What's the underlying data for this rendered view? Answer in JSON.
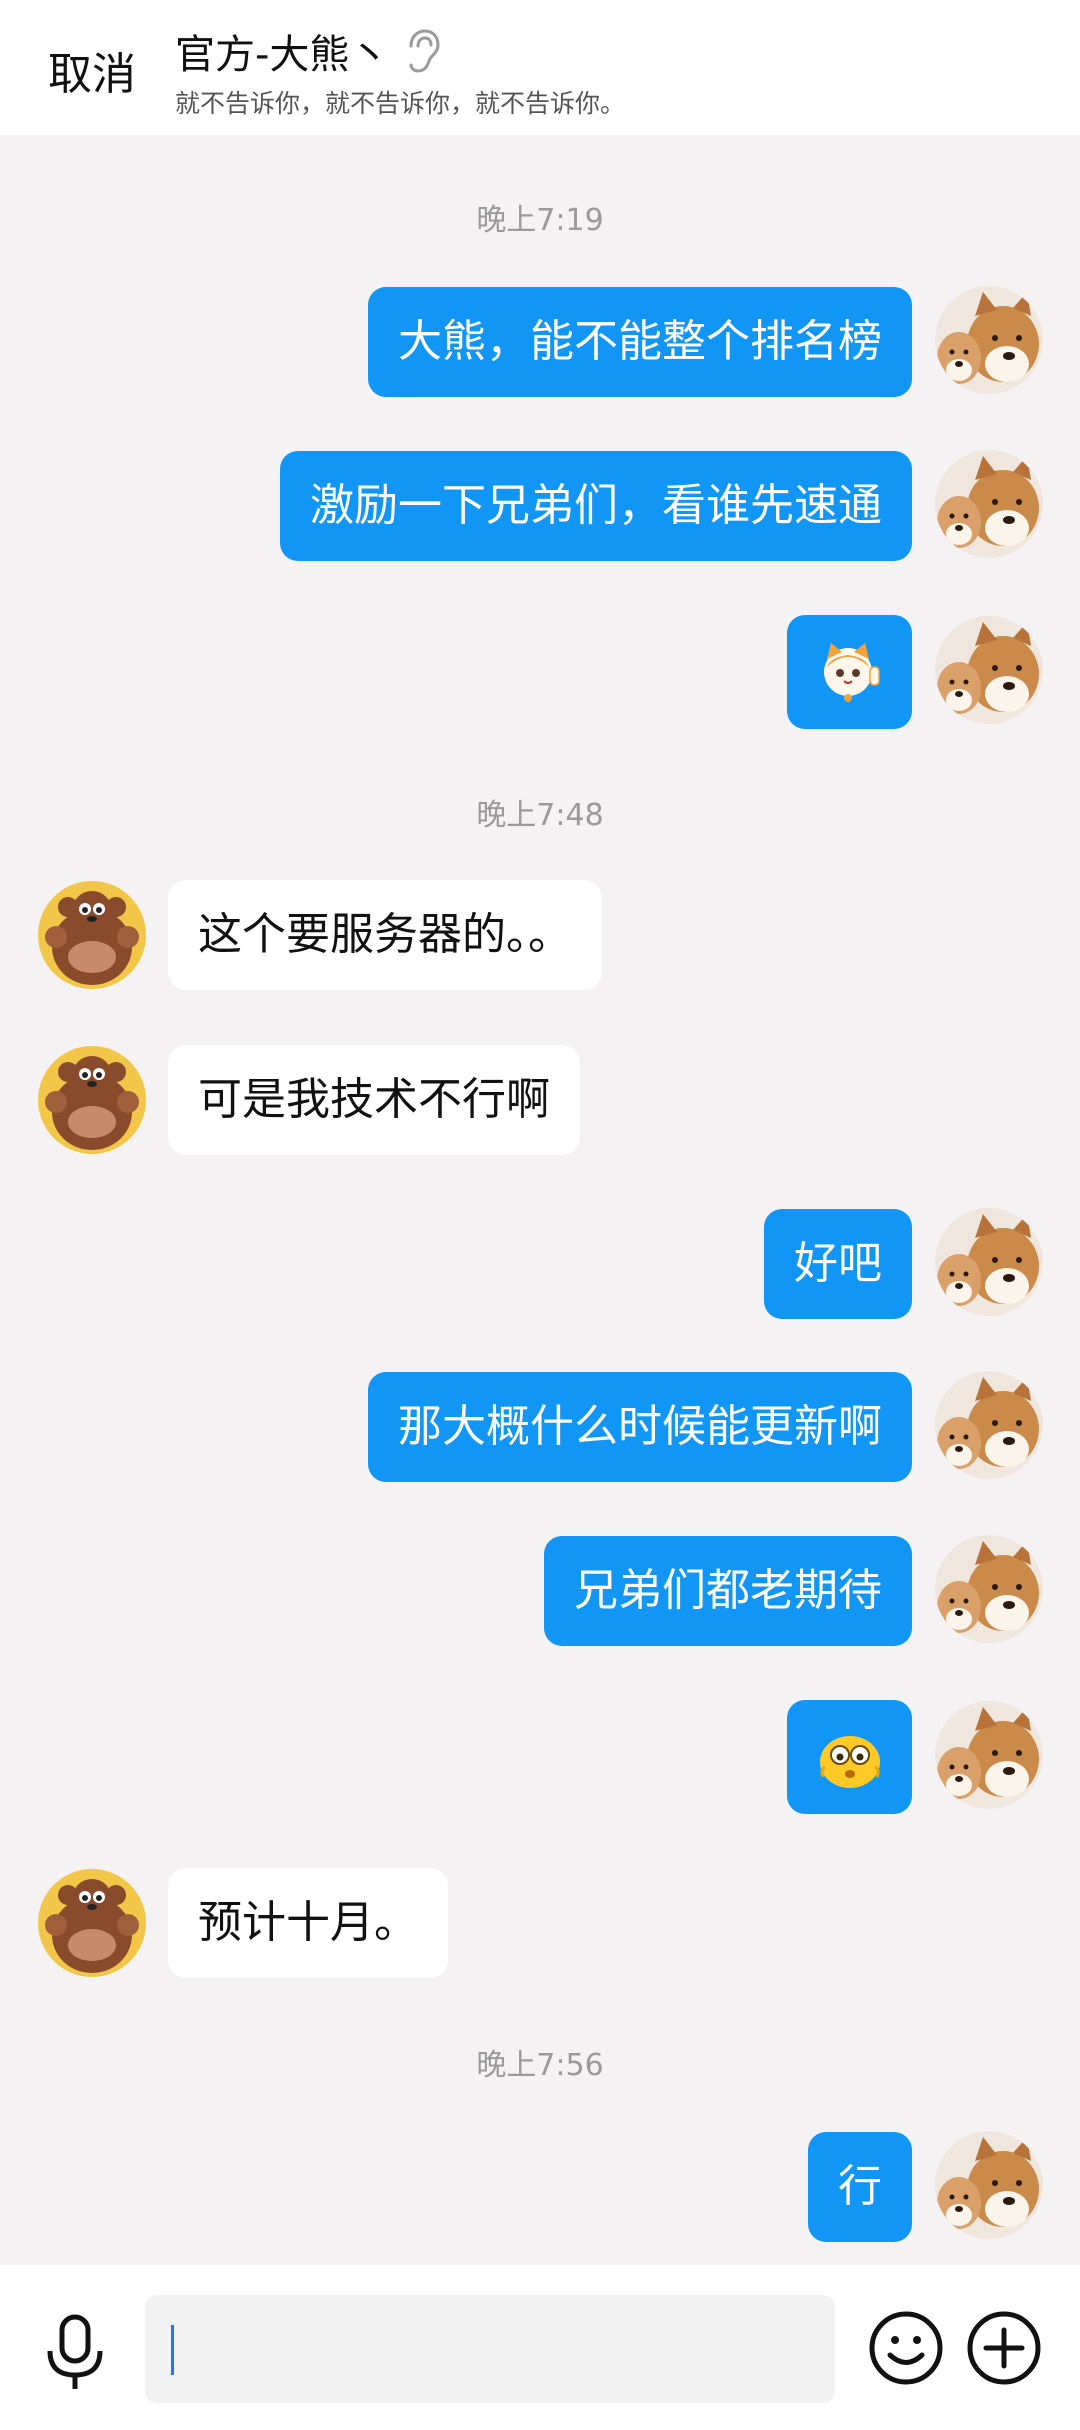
{
  "header": {
    "cancel_label": "取消",
    "title": "官方-大熊丶",
    "subtitle": "就不告诉你，就不告诉你，就不告诉你。",
    "icon": "ear-icon"
  },
  "messages": [
    {
      "type": "time",
      "text": "晚上7:19"
    },
    {
      "type": "out",
      "text": "大熊，能不能整个排名榜",
      "avatar": "shiba-avatar"
    },
    {
      "type": "out",
      "text": "激励一下兄弟们，看谁先速通",
      "avatar": "shiba-avatar"
    },
    {
      "type": "out",
      "sticker": "cat-sticker",
      "avatar": "shiba-avatar"
    },
    {
      "type": "time",
      "text": "晚上7:48"
    },
    {
      "type": "in",
      "text": "这个要服务器的。。",
      "avatar": "bear-avatar"
    },
    {
      "type": "in",
      "text": "可是我技术不行啊",
      "avatar": "bear-avatar"
    },
    {
      "type": "out",
      "text": "好吧",
      "avatar": "shiba-avatar"
    },
    {
      "type": "out",
      "text": "那大概什么时候能更新啊",
      "avatar": "shiba-avatar"
    },
    {
      "type": "out",
      "text": "兄弟们都老期待",
      "avatar": "shiba-avatar"
    },
    {
      "type": "out",
      "sticker": "emoji-sticker",
      "avatar": "shiba-avatar"
    },
    {
      "type": "in",
      "text": "预计十月。",
      "avatar": "bear-avatar"
    },
    {
      "type": "time",
      "text": "晚上7:56"
    },
    {
      "type": "out",
      "text": "行",
      "avatar": "shiba-avatar"
    }
  ],
  "input_bar": {
    "value": "",
    "icons": [
      "microphone-icon",
      "emoji-icon",
      "plus-icon"
    ]
  },
  "colors": {
    "accent": "#1296f5",
    "background": "#f4f2f3",
    "incoming_bubble": "#ffffff"
  }
}
